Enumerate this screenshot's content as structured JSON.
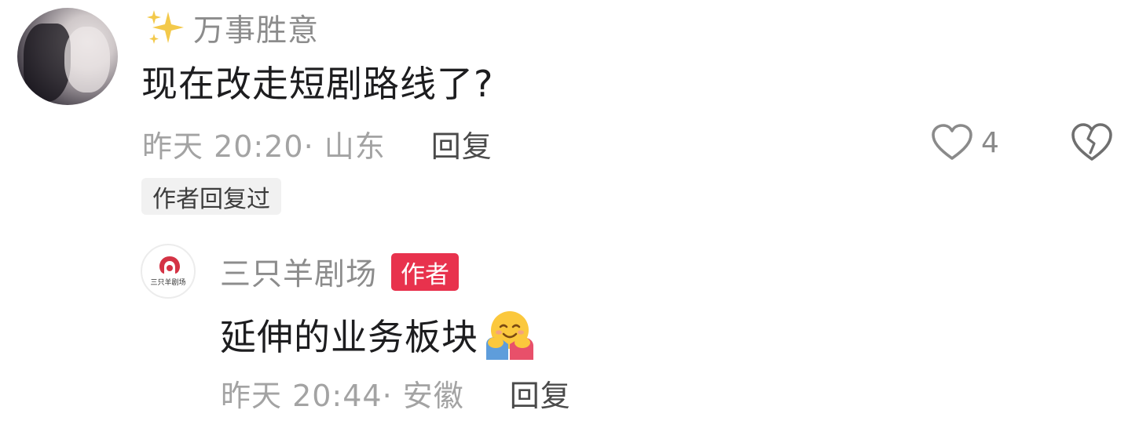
{
  "comment": {
    "username": "万事胜意",
    "username_icon": "sparkles-icon",
    "text": "现在改走短剧路线了?",
    "time_location": "昨天 20:20· 山东",
    "reply_label": "回复",
    "author_replied_badge": "作者回复过",
    "like_count": "4"
  },
  "reply": {
    "username": "三只羊剧场",
    "avatar_logo_text": "三只羊剧场",
    "author_tag": "作者",
    "text": "延伸的业务板块",
    "emoji": "hugging-face-emoji",
    "time_location": "昨天 20:44· 安徽",
    "reply_label": "回复"
  },
  "colors": {
    "author_tag_bg": "#e8324d",
    "meta_gray": "#a3a3a3",
    "name_gray": "#8c8c8c"
  }
}
